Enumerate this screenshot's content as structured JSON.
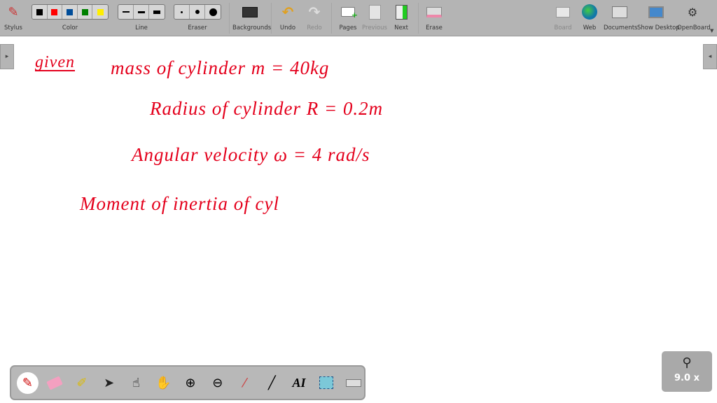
{
  "toolbar": {
    "stylus": "Stylus",
    "color": "Color",
    "line": "Line",
    "eraser": "Eraser",
    "backgrounds": "Backgrounds",
    "undo": "Undo",
    "redo": "Redo",
    "pages": "Pages",
    "previous": "Previous",
    "next": "Next",
    "erase": "Erase",
    "board": "Board",
    "web": "Web",
    "documents": "Documents",
    "show_desktop": "Show Desktop",
    "openboard": "OpenBoard",
    "colors": [
      "#000000",
      "#ff0000",
      "#004d99",
      "#008000",
      "#ffee00"
    ]
  },
  "board": {
    "lines": [
      "given",
      "mass of cylinder   m = 40kg",
      "Radius of cylinder   R = 0.2m",
      "Angular velocity     ω =  4 rad/s",
      "Moment of inertia of cyl"
    ],
    "ink_color": "#e4001c"
  },
  "zoom": {
    "value": "9.0 x"
  }
}
